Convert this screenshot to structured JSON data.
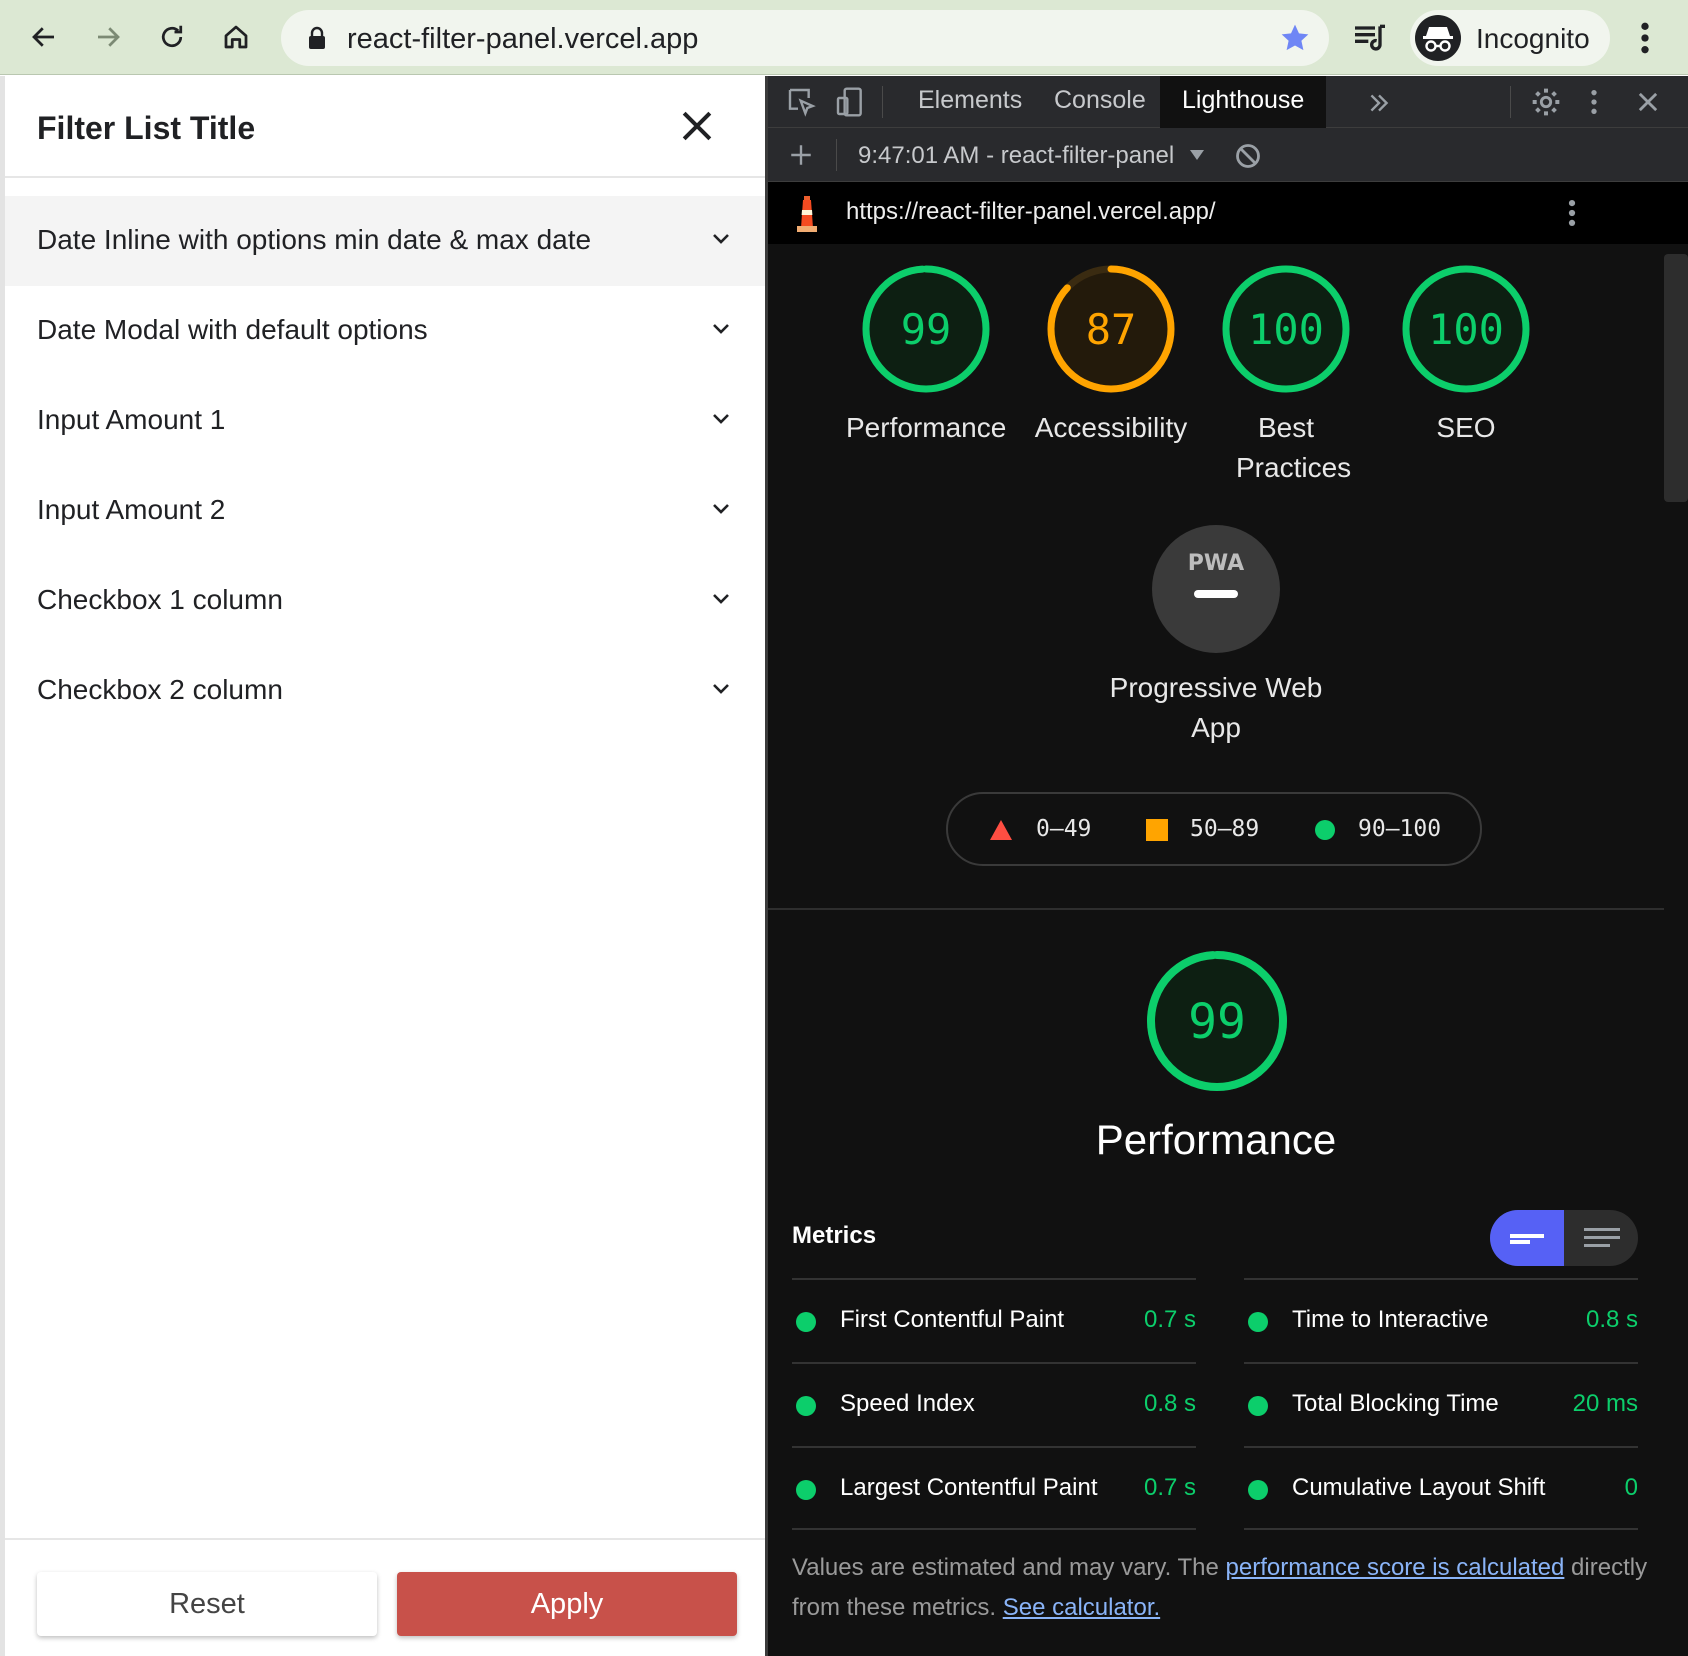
{
  "browser": {
    "url": "react-filter-panel.vercel.app",
    "profile_label": "Incognito"
  },
  "filter_panel": {
    "title": "Filter List Title",
    "items": [
      {
        "label": "Date Inline with options min date & max date"
      },
      {
        "label": "Date Modal with default options"
      },
      {
        "label": "Input Amount 1"
      },
      {
        "label": "Input Amount 2"
      },
      {
        "label": "Checkbox 1 column"
      },
      {
        "label": "Checkbox 2 column"
      }
    ],
    "reset_label": "Reset",
    "apply_label": "Apply"
  },
  "devtools": {
    "tabs": [
      "Elements",
      "Console",
      "Lighthouse"
    ],
    "active_tab": "Lighthouse",
    "report_selector": "9:47:01 AM - react-filter-panel",
    "report_url": "https://react-filter-panel.vercel.app/"
  },
  "lighthouse": {
    "scores": [
      {
        "score": "99",
        "label": "Performance",
        "value": 99,
        "color": "#0cce6b"
      },
      {
        "score": "87",
        "label": "Accessibility",
        "value": 87,
        "color": "#ffa400"
      },
      {
        "score": "100",
        "label": "Best Practices",
        "value": 100,
        "color": "#0cce6b"
      },
      {
        "score": "100",
        "label": "SEO",
        "value": 100,
        "color": "#0cce6b"
      }
    ],
    "pwa": {
      "badge": "PWA",
      "label": "Progressive Web App"
    },
    "legend": [
      {
        "range": "0–49",
        "color": "#ff4e42"
      },
      {
        "range": "50–89",
        "color": "#ffa400"
      },
      {
        "range": "90–100",
        "color": "#0cce6b"
      }
    ],
    "performance": {
      "score": "99",
      "value": 99,
      "title": "Performance",
      "metrics_heading": "Metrics",
      "metrics": [
        {
          "name": "First Contentful Paint",
          "value": "0.7 s"
        },
        {
          "name": "Time to Interactive",
          "value": "0.8 s"
        },
        {
          "name": "Speed Index",
          "value": "0.8 s"
        },
        {
          "name": "Total Blocking Time",
          "value": "20 ms"
        },
        {
          "name": "Largest Contentful Paint",
          "value": "0.7 s"
        },
        {
          "name": "Cumulative Layout Shift",
          "value": "0"
        }
      ],
      "note_prefix": "Values are estimated and may vary. The ",
      "note_link1": "performance score is calculated",
      "note_middle": " directly from these metrics. ",
      "note_link2": "See calculator."
    }
  }
}
